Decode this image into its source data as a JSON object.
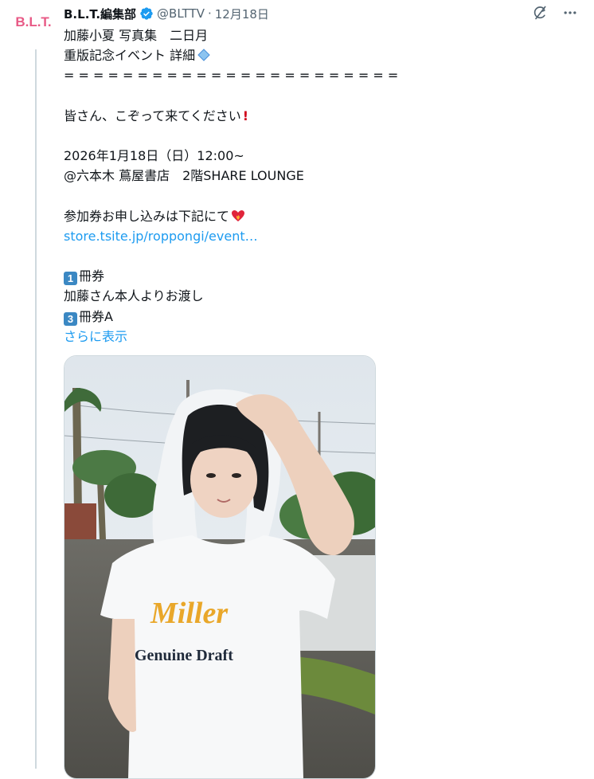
{
  "account": {
    "avatar_text": "B.L.T.",
    "display_name": "B.L.T.編集部",
    "handle": "@BLTTV",
    "separator": "·",
    "date": "12月18日"
  },
  "icons": {
    "verified": "verified-badge-icon",
    "grok": "grok-icon",
    "more": "more-icon",
    "keycap1": "keycap-1",
    "keycap3": "keycap-3",
    "excl": "red-exclamation",
    "heart": "heart-on-fire",
    "diamond": "small-blue-diamond"
  },
  "tweet": {
    "l1": "加藤小夏 写真集　二日月",
    "l2": "重版記念イベント 詳細",
    "l3": "= = = = = = = = = = = = = = = = = = = = = = =",
    "l4": "皆さん、こぞって来てください",
    "l5": "2026年1月18日（日）12:00~",
    "l6": "@六本木 蔦屋書店　2階SHARE LOUNGE",
    "l7": "参加券お申し込みは下記にて",
    "link": "store.tsite.jp/roppongi/event…",
    "kc1": "1",
    "l8": "冊券",
    "l9": "加藤さん本人よりお渡し",
    "kc3": "3",
    "l10": "冊券A",
    "show_more": "さらに表示"
  },
  "media": {
    "shirt_logo": "Miller",
    "shirt_text": "Genuine Draft"
  },
  "colors": {
    "link": "#1d9bf0",
    "verified": "#1d9bf0",
    "secondary_text": "#536471",
    "thread_line": "#cfd9de"
  }
}
